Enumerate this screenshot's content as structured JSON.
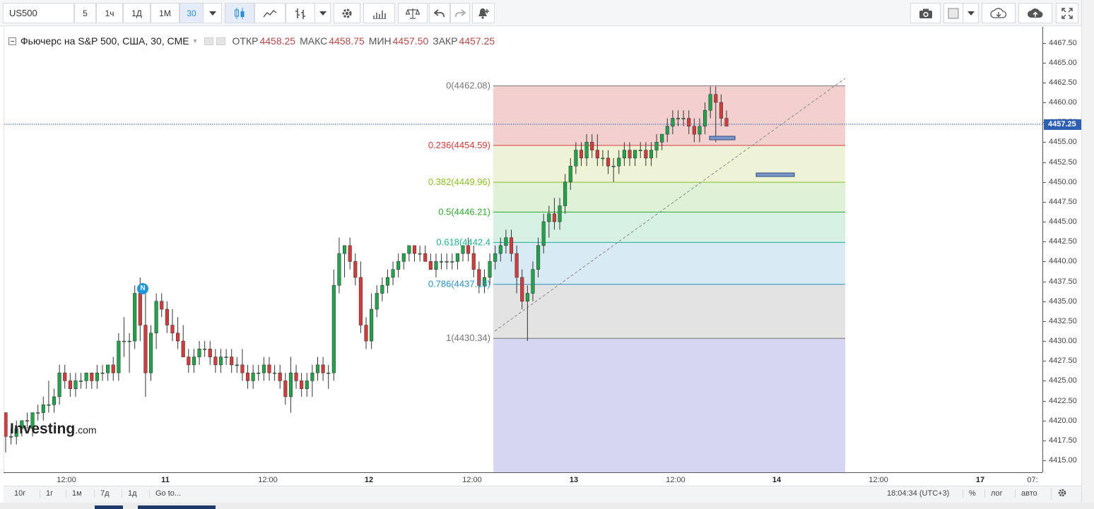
{
  "toolbar": {
    "symbol": "US500",
    "intervals": [
      "5",
      "1ч",
      "1Д",
      "1М",
      "30"
    ],
    "active_interval": "30"
  },
  "legend": {
    "title": "Фьючерс на S&P 500, США, 30, CME",
    "open_label": "ОТКР",
    "open": "4458.25",
    "high_label": "МАКС",
    "high": "4458.75",
    "low_label": "МИН",
    "low": "4457.50",
    "close_label": "ЗАКР",
    "close": "4457.25"
  },
  "price_axis": {
    "ticks": [
      "4467.50",
      "4465.00",
      "4462.50",
      "4460.00",
      "4457.50",
      "4455.00",
      "4452.50",
      "4450.00",
      "4447.50",
      "4445.00",
      "4442.50",
      "4440.00",
      "4437.50",
      "4435.00",
      "4432.50",
      "4430.00",
      "4427.50",
      "4425.00",
      "4422.50",
      "4420.00",
      "4417.50",
      "4415.00"
    ],
    "current_price": "4457.25"
  },
  "time_axis": {
    "labels": [
      "12:00",
      "11",
      "12:00",
      "12",
      "12:00",
      "13",
      "12:00",
      "14",
      "12:00",
      "17",
      "07:"
    ],
    "bold": [
      "11",
      "12",
      "13",
      "14",
      "17"
    ]
  },
  "fibonacci": {
    "levels": [
      {
        "label": "0(4462.08)",
        "color": "#777777",
        "fill": "#f3d0d0"
      },
      {
        "label": "0.236(4454.59)",
        "color": "#d23c3c",
        "fill": "#eef3d6"
      },
      {
        "label": "0.382(4449.96)",
        "color": "#8cbf2a",
        "fill": "#dff1d6"
      },
      {
        "label": "0.5(4446.21)",
        "color": "#2ea62e",
        "fill": "#d6f1e4"
      },
      {
        "label": "0.618(4442.4",
        "color": "#1fb08f",
        "fill": "#d8ebf2"
      },
      {
        "label": "0.786(4437.13)",
        "color": "#2b8fc4",
        "fill": "#e3e3e3"
      },
      {
        "label": "1(4430.34)",
        "color": "#777777",
        "fill": "#d6d6f2"
      }
    ]
  },
  "news_marker": "N",
  "watermark": {
    "brand": "Investing",
    "suffix": ".com"
  },
  "bottom_bar": {
    "ranges": [
      "10г",
      "1г",
      "1м",
      "7д",
      "1д"
    ],
    "goto": "Go to...",
    "clock": "18:04:34 (UTC+3)",
    "percent": "%",
    "log": "лог",
    "auto": "авто"
  },
  "colors": {
    "up": "#22a34b",
    "down": "#d23c3c",
    "price_tag": "#2d5fb3",
    "accent": "#2a8bd6"
  },
  "chart_data": {
    "type": "candlestick",
    "instrument": "US500",
    "interval": "30",
    "ylim": [
      4413.5,
      4469.5
    ],
    "ohlc": [
      [
        4421,
        4421,
        4416,
        4418
      ],
      [
        4418,
        4419,
        4417,
        4418
      ],
      [
        4418,
        4420,
        4417,
        4419
      ],
      [
        4419,
        4420,
        4418,
        4420
      ],
      [
        4420,
        4421,
        4419,
        4420
      ],
      [
        4419,
        4421,
        4418,
        4421
      ],
      [
        4421,
        4422,
        4420,
        4421
      ],
      [
        4421,
        4423,
        4420,
        4422
      ],
      [
        4422,
        4425,
        4421,
        4422
      ],
      [
        4422,
        4424,
        4421,
        4423
      ],
      [
        4423,
        4427,
        4422,
        4426
      ],
      [
        4426,
        4427,
        4424,
        4425
      ],
      [
        4425,
        4426,
        4423,
        4424
      ],
      [
        4424,
        4426,
        4423,
        4425
      ],
      [
        4425,
        4426,
        4424,
        4425
      ],
      [
        4425,
        4426,
        4424,
        4426
      ],
      [
        4426,
        4426,
        4424,
        4425
      ],
      [
        4425,
        4427,
        4424,
        4426
      ],
      [
        4426,
        4427,
        4425,
        4426
      ],
      [
        4426,
        4427,
        4425,
        4427
      ],
      [
        4427,
        4428,
        4425,
        4426
      ],
      [
        4426,
        4431,
        4425,
        4430
      ],
      [
        4430,
        4433,
        4428,
        4430
      ],
      [
        4430,
        4431,
        4426,
        4430
      ],
      [
        4430,
        4437,
        4429,
        4436
      ],
      [
        4436,
        4438,
        4430,
        4432
      ],
      [
        4432,
        4436,
        4423,
        4426
      ],
      [
        4426,
        4432,
        4425,
        4431
      ],
      [
        4431,
        4436,
        4429,
        4435
      ],
      [
        4435,
        4436,
        4433,
        4434
      ],
      [
        4434,
        4435,
        4431,
        4432
      ],
      [
        4432,
        4434,
        4430,
        4431
      ],
      [
        4431,
        4433,
        4429,
        4430
      ],
      [
        4430,
        4432,
        4428,
        4428
      ],
      [
        4428,
        4429,
        4426,
        4427
      ],
      [
        4427,
        4429,
        4426,
        4428
      ],
      [
        4428,
        4430,
        4427,
        4429
      ],
      [
        4429,
        4430,
        4428,
        4429
      ],
      [
        4429,
        4430,
        4427,
        4428
      ],
      [
        4428,
        4429,
        4426,
        4427
      ],
      [
        4427,
        4429,
        4426,
        4428
      ],
      [
        4428,
        4429,
        4427,
        4428
      ],
      [
        4428,
        4429,
        4426,
        4427
      ],
      [
        4427,
        4428,
        4426,
        4427
      ],
      [
        4427,
        4429,
        4425,
        4426
      ],
      [
        4426,
        4427,
        4424,
        4425
      ],
      [
        4425,
        4427,
        4424,
        4426
      ],
      [
        4426,
        4427,
        4425,
        4426
      ],
      [
        4426,
        4428,
        4425,
        4427
      ],
      [
        4427,
        4428,
        4425,
        4426
      ],
      [
        4426,
        4427,
        4425,
        4426
      ],
      [
        4426,
        4427,
        4424,
        4425
      ],
      [
        4425,
        4426,
        4422,
        4423
      ],
      [
        4423,
        4428,
        4421,
        4426
      ],
      [
        4426,
        4427,
        4424,
        4425
      ],
      [
        4425,
        4426,
        4423,
        4424
      ],
      [
        4424,
        4426,
        4423,
        4425
      ],
      [
        4425,
        4427,
        4423,
        4426
      ],
      [
        4426,
        4428,
        4425,
        4427
      ],
      [
        4427,
        4428,
        4425,
        4426
      ],
      [
        4426,
        4427,
        4424,
        4426
      ],
      [
        4426,
        4439,
        4425,
        4437
      ],
      [
        4437,
        4443,
        4436,
        4441
      ],
      [
        4441,
        4442,
        4438,
        4442
      ],
      [
        4442,
        4443,
        4439,
        4440
      ],
      [
        4440,
        4441,
        4437,
        4438
      ],
      [
        4438,
        4440,
        4431,
        4432
      ],
      [
        4432,
        4433,
        4429,
        4430
      ],
      [
        4430,
        4436,
        4429,
        4434
      ],
      [
        4434,
        4437,
        4433,
        4436
      ],
      [
        4436,
        4438,
        4435,
        4437
      ],
      [
        4437,
        4439,
        4436,
        4438
      ],
      [
        4438,
        4440,
        4437,
        4439
      ],
      [
        4439,
        4441,
        4438,
        4440
      ],
      [
        4440,
        4441,
        4439,
        4441
      ],
      [
        4441,
        4442,
        4440,
        4442
      ],
      [
        4442,
        4442,
        4440,
        4441
      ],
      [
        4441,
        4442,
        4440,
        4441
      ],
      [
        4441,
        4442,
        4440,
        4440
      ],
      [
        4440,
        4441,
        4439,
        4439
      ],
      [
        4439,
        4441,
        4438,
        4440
      ],
      [
        4440,
        4441,
        4439,
        4440
      ],
      [
        4440,
        4441,
        4439,
        4440
      ],
      [
        4440,
        4441,
        4439,
        4440
      ],
      [
        4440,
        4441,
        4439,
        4441
      ],
      [
        4441,
        4442,
        4440,
        4442
      ],
      [
        4442,
        4443,
        4440,
        4441
      ],
      [
        4441,
        4442,
        4438,
        4439
      ],
      [
        4439,
        4440,
        4436,
        4437
      ],
      [
        4437,
        4439,
        4436,
        4438
      ],
      [
        4438,
        4441,
        4437,
        4440
      ],
      [
        4440,
        4442,
        4439,
        4441
      ],
      [
        4441,
        4443,
        4440,
        4442
      ],
      [
        4442,
        4444,
        4441,
        4443
      ],
      [
        4443,
        4444,
        4440,
        4441
      ],
      [
        4441,
        4442,
        4436,
        4438
      ],
      [
        4438,
        4439,
        4434,
        4435
      ],
      [
        4435,
        4437,
        4430,
        4436
      ],
      [
        4436,
        4440,
        4435,
        4439
      ],
      [
        4439,
        4443,
        4438,
        4442
      ],
      [
        4442,
        4446,
        4441,
        4445
      ],
      [
        4445,
        4447,
        4443,
        4446
      ],
      [
        4446,
        4448,
        4444,
        4445
      ],
      [
        4445,
        4448,
        4444,
        4447
      ],
      [
        4447,
        4451,
        4446,
        4450
      ],
      [
        4450,
        4453,
        4449,
        4452
      ],
      [
        4452,
        4455,
        4451,
        4454
      ],
      [
        4454,
        4455,
        4452,
        4453
      ],
      [
        4453,
        4456,
        4452,
        4455
      ],
      [
        4455,
        4456,
        4453,
        4454
      ],
      [
        4454,
        4456,
        4452,
        4453
      ],
      [
        4453,
        4454,
        4452,
        4453
      ],
      [
        4453,
        4454,
        4451,
        4452
      ],
      [
        4452,
        4453,
        4450,
        4452
      ],
      [
        4452,
        4454,
        4451,
        4453
      ],
      [
        4453,
        4455,
        4452,
        4454
      ],
      [
        4454,
        4455,
        4452,
        4453
      ],
      [
        4453,
        4454,
        4452,
        4454
      ],
      [
        4454,
        4455,
        4453,
        4454
      ],
      [
        4454,
        4455,
        4452,
        4453
      ],
      [
        4453,
        4455,
        4452,
        4454
      ],
      [
        4454,
        4456,
        4453,
        4455
      ],
      [
        4455,
        4456,
        4454,
        4456
      ],
      [
        4456,
        4458,
        4455,
        4457
      ],
      [
        4457,
        4459,
        4456,
        4458
      ],
      [
        4458,
        4459,
        4457,
        4458
      ],
      [
        4458,
        4459,
        4457,
        4458
      ],
      [
        4458,
        4459,
        4456,
        4457
      ],
      [
        4457,
        4458,
        4455,
        4456
      ],
      [
        4456,
        4458,
        4455,
        4457
      ],
      [
        4457,
        4460,
        4456,
        4459
      ],
      [
        4459,
        4462,
        4458,
        4461
      ],
      [
        4461,
        4462,
        4455,
        4460
      ],
      [
        4460,
        4461,
        4457,
        4458
      ],
      [
        4458,
        4459,
        4457,
        4457
      ]
    ]
  }
}
